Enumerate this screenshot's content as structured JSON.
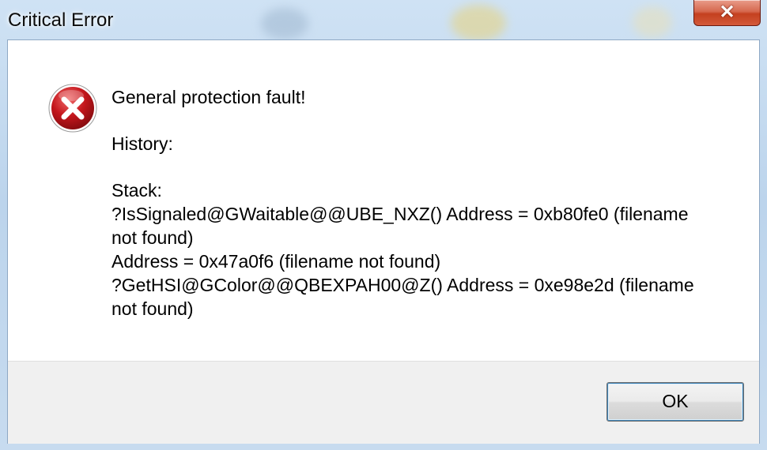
{
  "window": {
    "title": "Critical Error",
    "close_glyph": "✕"
  },
  "icon": {
    "name": "error-icon",
    "color": "#c4161c"
  },
  "message": {
    "heading": "General protection fault!",
    "history_label": "History:",
    "stack_label": "Stack:",
    "stack_lines": [
      "?IsSignaled@GWaitable@@UBE_NXZ() Address = 0xb80fe0    (filename",
      "not found)",
      "Address = 0x47a0f6    (filename not found)",
      "?GetHSI@GColor@@QBEXPAH00@Z() Address = 0xe98e2d    (filename",
      "not found)"
    ]
  },
  "buttons": {
    "ok_label": "OK"
  }
}
